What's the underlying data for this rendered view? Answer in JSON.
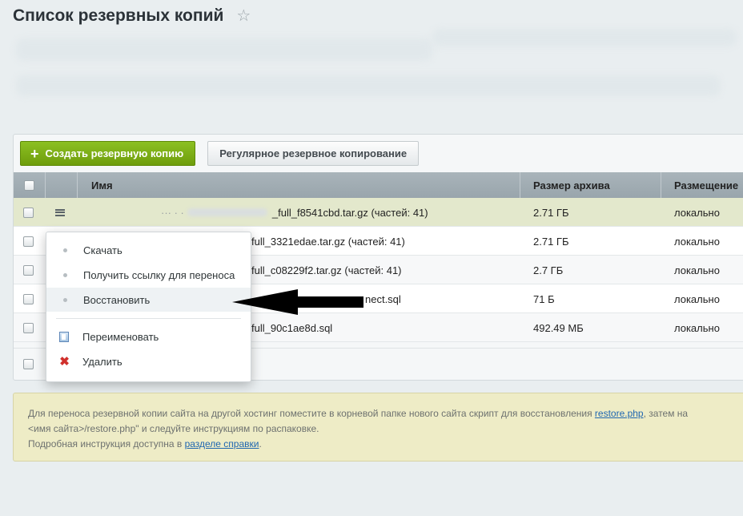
{
  "page": {
    "title": "Список резервных копий",
    "star_glyph": "☆"
  },
  "toolbar": {
    "create_plus": "+",
    "create_label": "Создать резервную копию",
    "schedule_label": "Регулярное резервное копирование"
  },
  "table": {
    "headers": {
      "name": "Имя",
      "size": "Размер архива",
      "location": "Размещение"
    },
    "rows": [
      {
        "name_prefix": "··· · ·",
        "name": "_full_f8541cbd.tar.gz (частей: 41)",
        "size": "2.71 ГБ",
        "location": "локально"
      },
      {
        "name_prefix": "",
        "name": "full_3321edae.tar.gz (частей: 41)",
        "size": "2.71 ГБ",
        "location": "локально"
      },
      {
        "name_prefix": "",
        "name": "full_c08229f2.tar.gz (частей: 41)",
        "size": "2.7 ГБ",
        "location": "локально"
      },
      {
        "name_prefix": "",
        "name": "nect.sql",
        "size": "71 Б",
        "location": "локально"
      },
      {
        "name_prefix": "",
        "name": "full_90c1ae8d.sql",
        "size": "492.49 МБ",
        "location": "локально"
      }
    ]
  },
  "menu": {
    "download": "Скачать",
    "get_link": "Получить ссылку для переноса",
    "restore": "Восстановить",
    "rename": "Переименовать",
    "delete": "Удалить",
    "delete_glyph": "✖"
  },
  "info": {
    "line1_pre": "Для переноса резервной копии сайта на другой хостинг поместите в корневой папке нового сайта скрипт для восстановления ",
    "line1_link": "restore.php",
    "line1_post": ", затем на",
    "line2": "<имя сайта>/restore.php\" и следуйте инструкциям по распаковке.",
    "line3_pre": "Подробная инструкция доступна в ",
    "line3_link": "разделе справки",
    "line3_post": "."
  },
  "colors": {
    "create_button": "#7aab16",
    "selected_row": "#e3e8cc",
    "info_background": "#eeecc6",
    "link": "#2067b0",
    "delete_icon": "#d0302c"
  }
}
